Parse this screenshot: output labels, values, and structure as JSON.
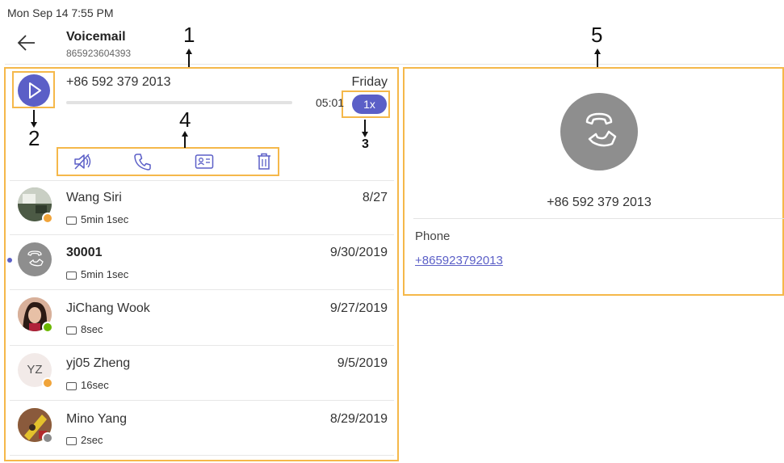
{
  "status_bar": {
    "datetime": "Mon Sep 14  7:55 PM"
  },
  "header": {
    "title": "Voicemail",
    "subtitle": "865923604393",
    "back_icon": "arrow-left-icon"
  },
  "selected_voicemail": {
    "number": "+86 592 379 2013",
    "day": "Friday",
    "duration": "05:01",
    "speed": "1x",
    "progress": 0,
    "actions": [
      {
        "name": "speaker-off-icon"
      },
      {
        "name": "call-icon"
      },
      {
        "name": "contact-card-icon"
      },
      {
        "name": "delete-icon"
      }
    ]
  },
  "voicemails": [
    {
      "name": "Wang Siri",
      "date": "8/27",
      "duration": "5min 1sec",
      "bold": false,
      "avatar": "photo",
      "presence": "away"
    },
    {
      "name": "30001",
      "date": "9/30/2019",
      "duration": "5min 1sec",
      "bold": true,
      "avatar": "phone",
      "unread": true
    },
    {
      "name": "JiChang Wook",
      "date": "9/27/2019",
      "duration": "8sec",
      "bold": false,
      "avatar": "photo",
      "presence": "available"
    },
    {
      "name": "yj05 Zheng",
      "date": "9/5/2019",
      "duration": "16sec",
      "bold": false,
      "avatar": "initials",
      "initials": "YZ",
      "presence": "away"
    },
    {
      "name": "Mino Yang",
      "date": "8/29/2019",
      "duration": "2sec",
      "bold": false,
      "avatar": "photo",
      "presence": "offline"
    }
  ],
  "detail": {
    "number": "+86 592 379 2013",
    "phone_label": "Phone",
    "phone_value": "+865923792013"
  },
  "annotations": {
    "a1": "1",
    "a2": "2",
    "a3": "3",
    "a4": "4",
    "a5": "5"
  },
  "colors": {
    "accent": "#5b5fc7",
    "callout": "#f5b84a",
    "away": "#f0a43a",
    "available": "#6bb700",
    "offline": "#8a8a8a"
  }
}
